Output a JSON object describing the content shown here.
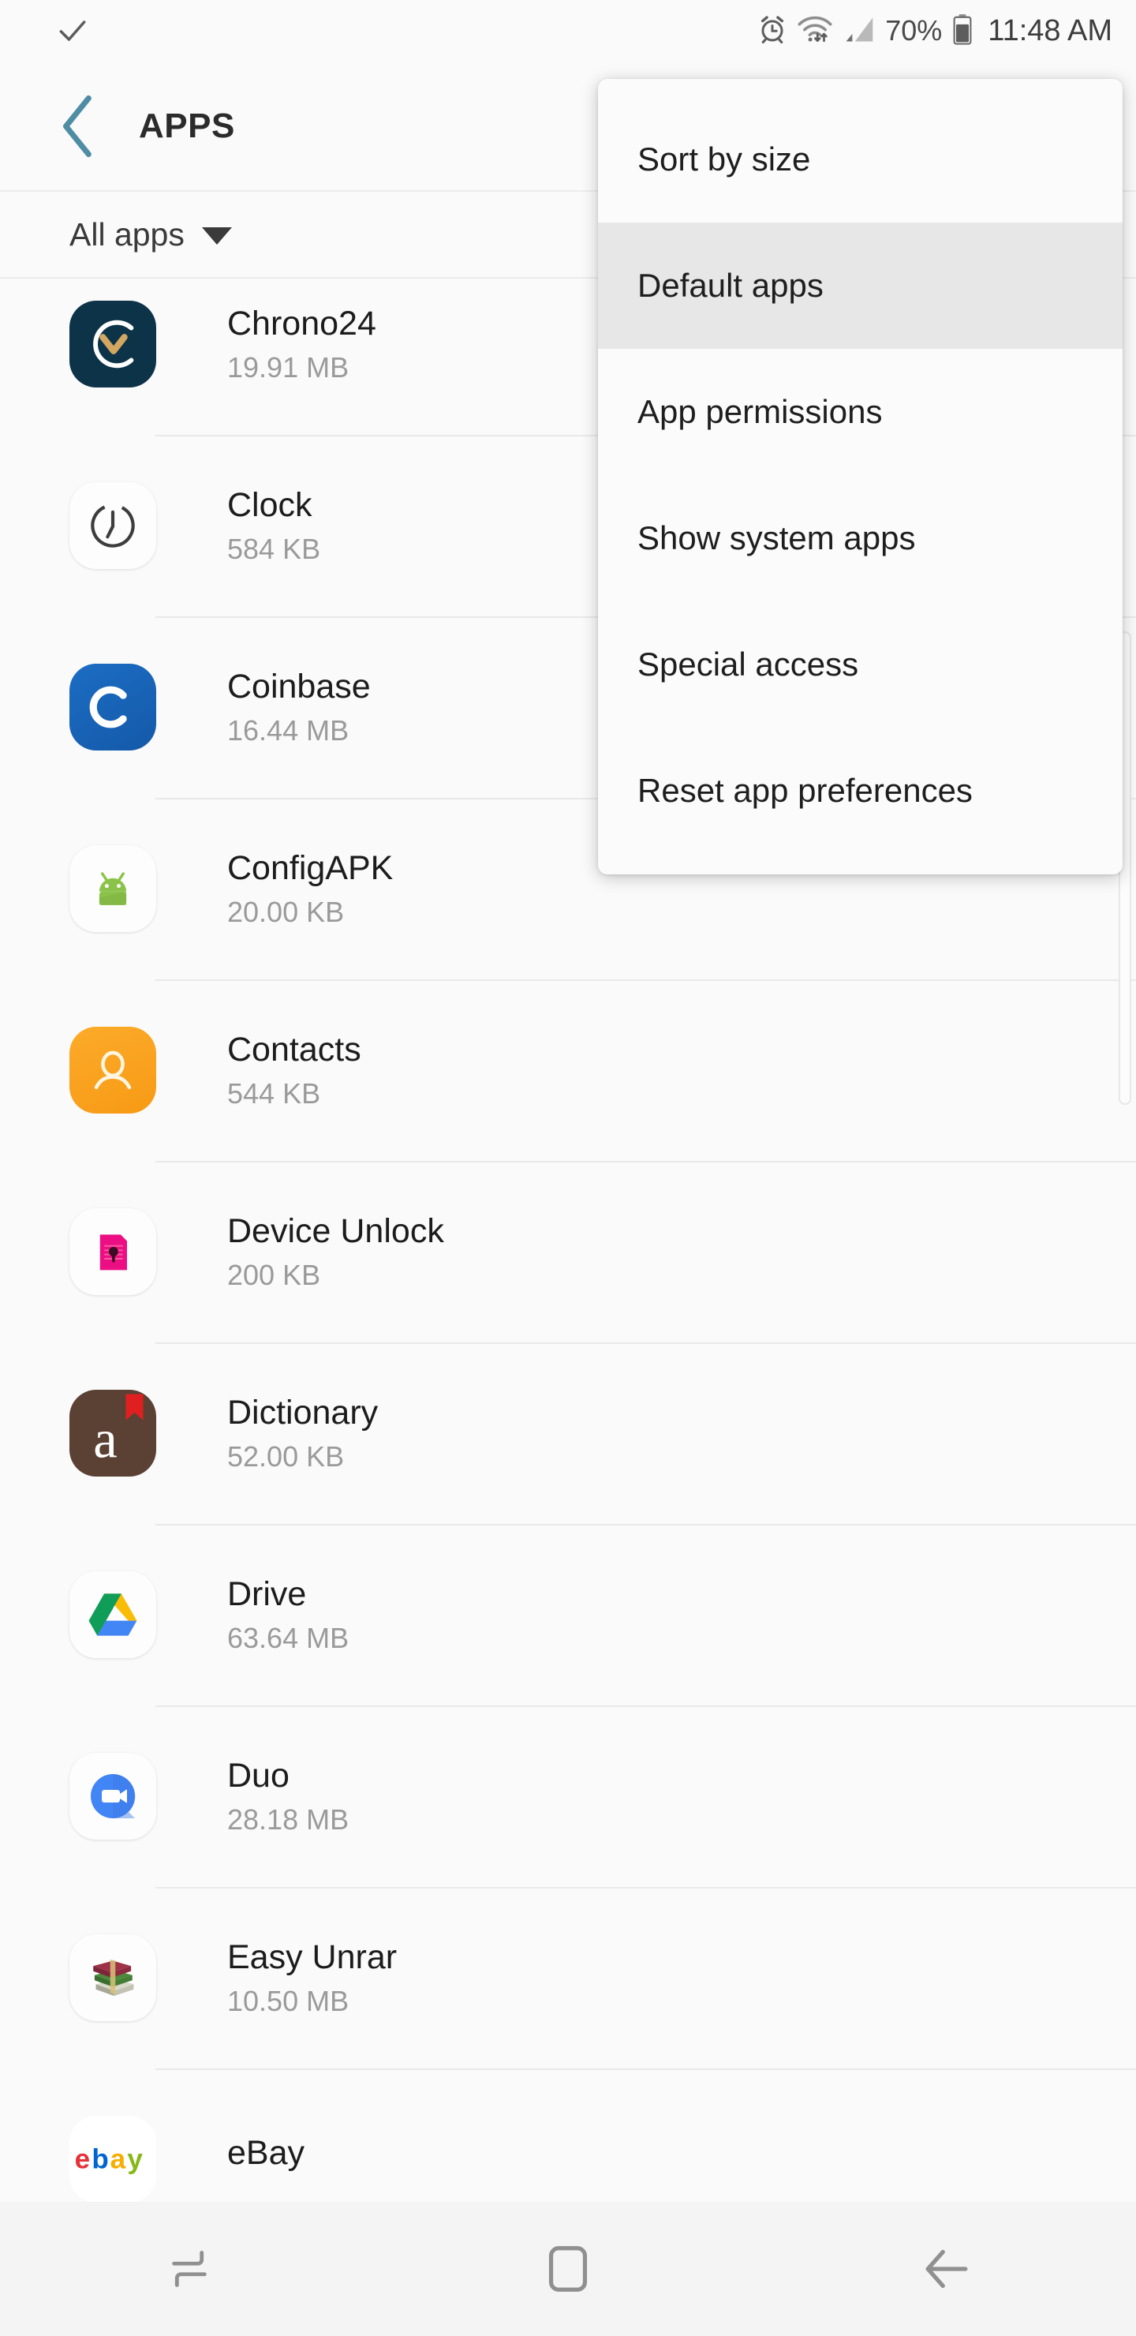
{
  "status_bar": {
    "left_icon": "checkmark-icon",
    "icons": [
      "alarm-icon",
      "wifi-icon",
      "signal-icon"
    ],
    "battery_percent": "70%",
    "battery_icon": "battery-icon",
    "time": "11:48 AM"
  },
  "action_bar": {
    "back_icon": "back-chevron-icon",
    "back_color": "#4e8da4",
    "title": "APPS"
  },
  "filter_bar": {
    "label": "All apps",
    "caret_icon": "caret-down-icon"
  },
  "menu": {
    "items": [
      {
        "label": "Sort by size",
        "highlighted": false
      },
      {
        "label": "Default apps",
        "highlighted": true
      },
      {
        "label": "App permissions",
        "highlighted": false
      },
      {
        "label": "Show system apps",
        "highlighted": false
      },
      {
        "label": "Special access",
        "highlighted": false
      },
      {
        "label": "Reset app preferences",
        "highlighted": false
      }
    ]
  },
  "app_list": [
    {
      "name": "Chrono24",
      "size": "19.91 MB",
      "icon": "chrono24-icon"
    },
    {
      "name": "Clock",
      "size": "584 KB",
      "icon": "clock-icon"
    },
    {
      "name": "Coinbase",
      "size": "16.44 MB",
      "icon": "coinbase-icon"
    },
    {
      "name": "ConfigAPK",
      "size": "20.00 KB",
      "icon": "android-icon"
    },
    {
      "name": "Contacts",
      "size": "544 KB",
      "icon": "contacts-icon"
    },
    {
      "name": "Device Unlock",
      "size": "200 KB",
      "icon": "device-unlock-icon"
    },
    {
      "name": "Dictionary",
      "size": "52.00 KB",
      "icon": "dictionary-icon"
    },
    {
      "name": "Drive",
      "size": "63.64 MB",
      "icon": "google-drive-icon"
    },
    {
      "name": "Duo",
      "size": "28.18 MB",
      "icon": "google-duo-icon"
    },
    {
      "name": "Easy Unrar",
      "size": "10.50 MB",
      "icon": "easy-unrar-icon"
    },
    {
      "name": "eBay",
      "size": "",
      "icon": "ebay-icon"
    }
  ],
  "nav_bar": {
    "recents_icon": "recents-icon",
    "home_icon": "home-icon",
    "back_icon": "nav-back-icon"
  },
  "colors": {
    "background": "#fafafa",
    "accent": "#4e8da4",
    "divider": "#e9e9e9",
    "menu_highlight": "#e7e7e7",
    "nav_bar": "#f4f4f4"
  }
}
